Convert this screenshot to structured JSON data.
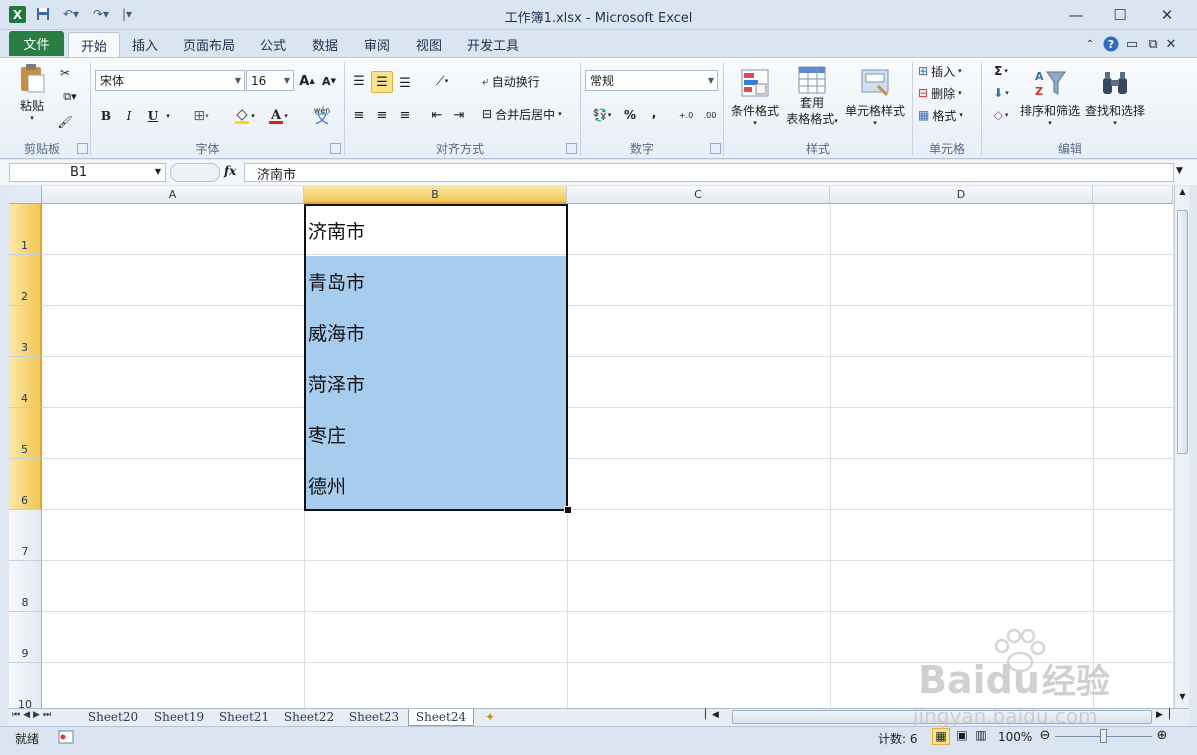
{
  "window": {
    "title": "工作簿1.xlsx  -  Microsoft Excel",
    "app_icon": "X",
    "controls": {
      "minimize": "—",
      "maximize": "☐",
      "close": "✕"
    }
  },
  "ribbon_tabs": {
    "file": "文件",
    "tabs": [
      "开始",
      "插入",
      "页面布局",
      "公式",
      "数据",
      "审阅",
      "视图",
      "开发工具"
    ],
    "active": "开始"
  },
  "clipboard": {
    "paste": "粘贴",
    "label": "剪贴板"
  },
  "font": {
    "name": "宋体",
    "size": "16",
    "label": "字体",
    "bold": "B",
    "italic": "I",
    "underline": "U",
    "grow": "A",
    "shrink": "A",
    "wen": "wén"
  },
  "alignment": {
    "wrap": "自动换行",
    "merge": "合并后居中",
    "label": "对齐方式"
  },
  "number": {
    "format": "常规",
    "percent": "%",
    "comma": ",",
    "inc": "+.0",
    "dec": ".00",
    "label": "数字"
  },
  "styles": {
    "conditional": "条件格式",
    "table_l1": "套用",
    "table_l2": "表格格式",
    "cell_styles": "单元格样式",
    "label": "样式"
  },
  "cells": {
    "insert": "插入",
    "delete": "删除",
    "format": "格式",
    "label": "单元格"
  },
  "editing": {
    "sigma": "Σ",
    "sort": "排序和筛选",
    "find": "查找和选择",
    "label": "编辑"
  },
  "formula_bar": {
    "name_box": "B1",
    "fx": "fx",
    "value": "济南市"
  },
  "columns": [
    "A",
    "B",
    "C",
    "D"
  ],
  "rows": [
    "1",
    "2",
    "3",
    "4",
    "5",
    "6",
    "7",
    "8",
    "9",
    "10"
  ],
  "cells_b": [
    "济南市",
    "青岛市",
    "威海市",
    "菏泽市",
    "枣庄",
    "德州"
  ],
  "sheets": [
    "Sheet20",
    "Sheet19",
    "Sheet21",
    "Sheet22",
    "Sheet23",
    "Sheet24"
  ],
  "active_sheet": "Sheet24",
  "status": {
    "ready": "就绪",
    "count": "计数: 6",
    "zoom": "100%"
  },
  "watermark": {
    "brand": "Bai",
    "brand2": "du",
    "cn": "经验",
    "url": "jingyan.baidu.com"
  }
}
